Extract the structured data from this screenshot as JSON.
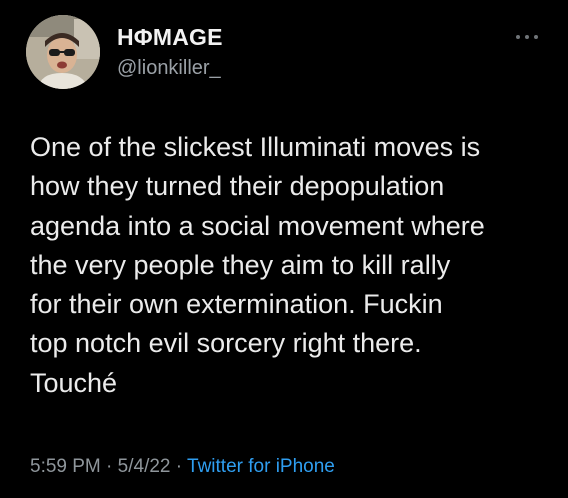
{
  "user": {
    "display_name": "HΦMAGE",
    "handle": "@lionkiller_",
    "avatar_icon": "profile-photo"
  },
  "tweet": {
    "text": "One of the slickest Illuminati moves is\nhow they turned their depopulation\nagenda into a social movement where\nthe very people they aim to kill rally\nfor their own extermination. Fuckin\ntop notch evil sorcery right there.\nTouché"
  },
  "meta": {
    "time": "5:59 PM",
    "separator": " · ",
    "date": "5/4/22",
    "source": "Twitter for iPhone"
  },
  "icons": {
    "more": "more-options-icon"
  },
  "colors": {
    "background": "#000000",
    "text": "#e7e9ea",
    "secondary": "#8f969b",
    "link": "#2f9ef0"
  }
}
